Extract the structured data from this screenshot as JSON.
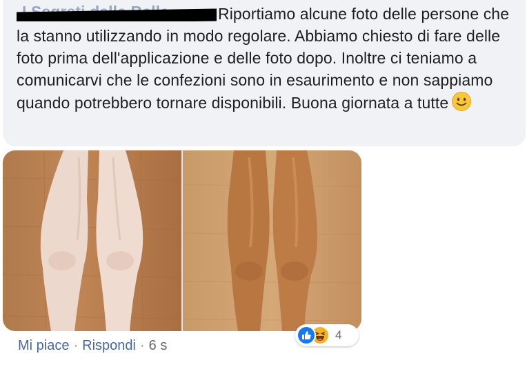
{
  "comment": {
    "author": "I Segreti della Bella",
    "text": "Riportiamo alcune foto delle persone che la stanno utilizzando in modo regolare. Abbiamo chiesto di fare delle foto prima dell'applicazione e delle foto dopo. Inoltre ci teniamo a comunicarvi che le confezioni sono in esaurimento e non sappiamo quando potrebbero tornare disponibili. Buona giornata a tutte",
    "emoji": "slightly-smiling-face-emoji"
  },
  "photos": {
    "before": "legs-before-photo",
    "after": "legs-after-photo"
  },
  "reactions": {
    "icons": [
      "like-icon",
      "haha-icon"
    ],
    "count": "4"
  },
  "actions": {
    "like_label": "Mi piace",
    "reply_label": "Rispondi",
    "separator": "·",
    "timestamp": "6 s"
  },
  "colors": {
    "bubble": "#f0f2f5",
    "link": "#4b67a1",
    "like": "#1877f2",
    "haha": "#f7b125"
  }
}
